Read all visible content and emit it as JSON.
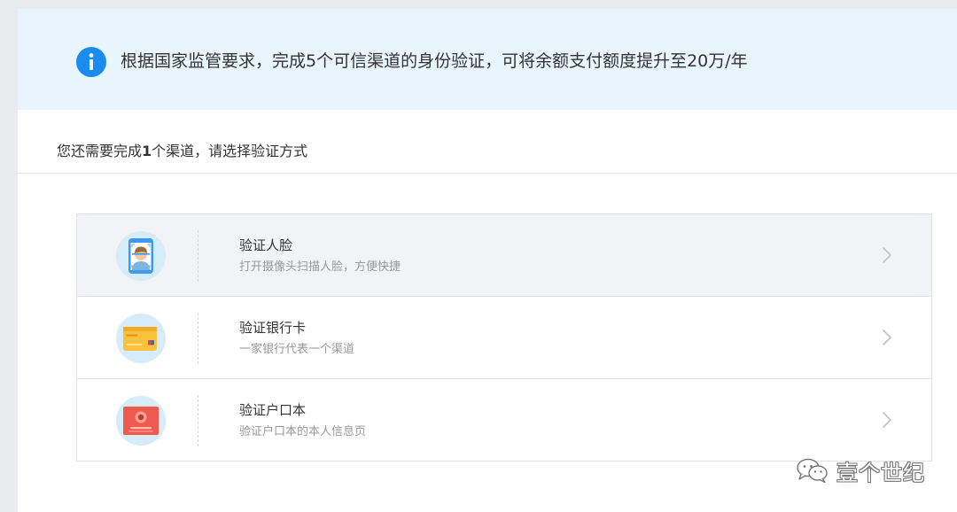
{
  "notice": {
    "text": "根据国家监管要求，完成5个可信渠道的身份验证，可将余额支付额度提升至20万/年",
    "icon": "info-icon",
    "accent_color": "#1a8cf0",
    "background_color": "#e9f5fd"
  },
  "sub_header": {
    "prefix": "您还需要完成",
    "count": "1",
    "suffix": "个渠道，请选择验证方式"
  },
  "options": [
    {
      "title": "验证人脸",
      "desc": "打开摄像头扫描人脸，方便快捷",
      "icon": "face-scan-icon",
      "hover": true
    },
    {
      "title": "验证银行卡",
      "desc": "一家银行代表一个渠道",
      "icon": "bank-card-icon",
      "hover": false
    },
    {
      "title": "验证户口本",
      "desc": "验证户口本的本人信息页",
      "icon": "household-register-icon",
      "hover": false
    }
  ],
  "watermark": {
    "text": "壹个世纪",
    "icon": "wechat-icon"
  }
}
